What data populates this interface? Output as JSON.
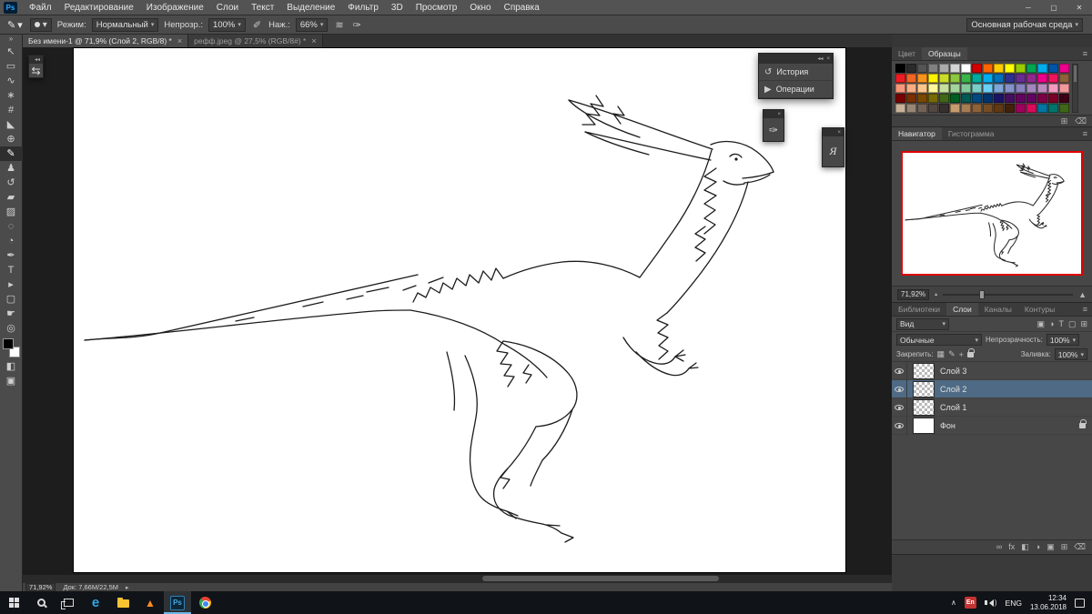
{
  "app": {
    "logo": "Ps"
  },
  "window_controls": {
    "minimize": "─",
    "maximize": "▢",
    "close": "✕"
  },
  "menu_bar": {
    "items": [
      "Файл",
      "Редактирование",
      "Изображение",
      "Слои",
      "Текст",
      "Выделение",
      "Фильтр",
      "3D",
      "Просмотр",
      "Окно",
      "Справка"
    ]
  },
  "ui": {
    "caret": "▾",
    "panel_menu": "≡",
    "toolbar_collapse": "»",
    "float_collapse": "◂◂",
    "float_close": "×",
    "status_arrow": "▸",
    "zoom_out": "▴",
    "zoom_in": "▲",
    "hidden_icons": "∧",
    "wave": ")"
  },
  "options_bar": {
    "tool_icon": "✎",
    "mode_label": "Режим:",
    "mode_value": "Нормальный",
    "opacity_label": "Непрозр.:",
    "opacity_value": "100%",
    "pressure_opacity_icon": "✐",
    "flow_label": "Наж.:",
    "flow_value": "66%",
    "pressure_size_icon": "✑",
    "airbrush_icon": "≋",
    "workspace_value": "Основная рабочая среда"
  },
  "document_tabs": [
    {
      "title": "Без имени-1 @ 71,9% (Слой 2, RGB/8) *",
      "close_glyph": "×",
      "active": true
    },
    {
      "title": "рефф.jpeg @ 27,5% (RGB/8#) *",
      "close_glyph": "×",
      "active": false
    }
  ],
  "toolbar": {
    "tools": [
      {
        "name": "move-tool",
        "glyph": "↖"
      },
      {
        "name": "marquee-tool",
        "glyph": "▭"
      },
      {
        "name": "lasso-tool",
        "glyph": "∿"
      },
      {
        "name": "magic-wand-tool",
        "glyph": "∗"
      },
      {
        "name": "crop-tool",
        "glyph": "#"
      },
      {
        "name": "eyedropper-tool",
        "glyph": "◣"
      },
      {
        "name": "healing-brush-tool",
        "glyph": "⊕"
      },
      {
        "name": "brush-tool",
        "glyph": "✎",
        "selected": true
      },
      {
        "name": "clone-stamp-tool",
        "glyph": "♟"
      },
      {
        "name": "history-brush-tool",
        "glyph": "↺"
      },
      {
        "name": "eraser-tool",
        "glyph": "▰"
      },
      {
        "name": "gradient-tool",
        "glyph": "▨"
      },
      {
        "name": "blur-tool",
        "glyph": "◌"
      },
      {
        "name": "dodge-tool",
        "glyph": "◔"
      },
      {
        "name": "pen-tool",
        "glyph": "✒"
      },
      {
        "name": "type-tool",
        "glyph": "T"
      },
      {
        "name": "path-selection-tool",
        "glyph": "▸"
      },
      {
        "name": "shape-tool",
        "glyph": "▢"
      },
      {
        "name": "hand-tool",
        "glyph": "☛"
      },
      {
        "name": "zoom-tool",
        "glyph": "◎"
      }
    ],
    "quick_mask_glyph": "◧",
    "screen_mode_glyph": "▣"
  },
  "status_bar": {
    "zoom": "71,92%",
    "doc": "Док: 7,66M/22,5M"
  },
  "panels": {
    "color": {
      "tabs": [
        "Цвет",
        "Образцы"
      ],
      "active": "Образцы"
    },
    "swatches_footer": [
      {
        "name": "new-swatch-icon",
        "glyph": "⊞"
      },
      {
        "name": "delete-swatch-icon",
        "glyph": "⌫"
      }
    ],
    "navigator": {
      "tabs": [
        "Навигатор",
        "Гистограмма"
      ],
      "active": "Навигатор",
      "zoom": "71,92%"
    },
    "layers_group": {
      "tabs": [
        "Библиотеки",
        "Слои",
        "Каналы",
        "Контуры"
      ],
      "active": "Слои"
    },
    "layers": {
      "filter_label": "Вид",
      "filter_icons": [
        {
          "name": "filter-pixel-icon",
          "glyph": "▣"
        },
        {
          "name": "filter-adjustment-icon",
          "glyph": "◑"
        },
        {
          "name": "filter-type-icon",
          "glyph": "T"
        },
        {
          "name": "filter-shape-icon",
          "glyph": "▢"
        },
        {
          "name": "filter-smart-icon",
          "glyph": "⊞"
        }
      ],
      "blend_mode": "Обычные",
      "opacity_label": "Непрозрачность:",
      "opacity_value": "100%",
      "lock_label": "Закрепить:",
      "lock_icons": [
        {
          "name": "lock-transparency-icon",
          "glyph": "▦"
        },
        {
          "name": "lock-pixels-icon",
          "glyph": "✎"
        },
        {
          "name": "lock-position-icon",
          "glyph": "+"
        }
      ],
      "fill_label": "Заливка:",
      "fill_value": "100%",
      "items": [
        {
          "name": "Слой 3",
          "visible": true,
          "selected": false,
          "type": "pixel"
        },
        {
          "name": "Слой 2",
          "visible": true,
          "selected": true,
          "type": "pixel"
        },
        {
          "name": "Слой 1",
          "visible": true,
          "selected": false,
          "type": "pixel"
        },
        {
          "name": "Фон",
          "visible": true,
          "selected": false,
          "type": "background",
          "locked": true
        }
      ],
      "footer_icons": [
        {
          "name": "link-layers-icon",
          "glyph": "∞"
        },
        {
          "name": "layer-effects-icon",
          "glyph": "fx"
        },
        {
          "name": "layer-mask-icon",
          "glyph": "◧"
        },
        {
          "name": "adjustment-layer-icon",
          "glyph": "◑"
        },
        {
          "name": "layer-group-icon",
          "glyph": "▣"
        },
        {
          "name": "new-layer-icon",
          "glyph": "⊞"
        },
        {
          "name": "delete-layer-icon",
          "glyph": "⌫"
        }
      ]
    }
  },
  "palette": [
    [
      "#000000",
      "#2b2b2b",
      "#555555",
      "#808080",
      "#aaaaaa",
      "#d4d4d4",
      "#ffffff",
      "#d40000",
      "#ff6600",
      "#ffcc00",
      "#ffff00",
      "#99cc00",
      "#00a651",
      "#00aeef",
      "#0054a6",
      "#ec008c"
    ],
    [
      "#ed1c24",
      "#f26522",
      "#f7941d",
      "#fff200",
      "#cbdb2a",
      "#8dc63f",
      "#39b54a",
      "#00a99d",
      "#00aeef",
      "#0072bc",
      "#2e3192",
      "#662d91",
      "#92278f",
      "#ec008c",
      "#ed145b",
      "#8c6239"
    ],
    [
      "#f7977a",
      "#fbad82",
      "#fdc68c",
      "#fff799",
      "#c6df9c",
      "#a4d49d",
      "#82ca9c",
      "#7bcdc9",
      "#6ccff7",
      "#7ea7d8",
      "#8493ca",
      "#8882be",
      "#a286bd",
      "#bc8cbf",
      "#f49bc1",
      "#f5989d"
    ],
    [
      "#790000",
      "#7b2e00",
      "#7a4900",
      "#786a02",
      "#406618",
      "#005e20",
      "#005952",
      "#004a80",
      "#003471",
      "#1b1464",
      "#450e61",
      "#62055f",
      "#630460",
      "#7b0046",
      "#7a0026",
      "#3d0017"
    ],
    [
      "#c7b299",
      "#998675",
      "#736357",
      "#534741",
      "#362f2d",
      "#c69c6d",
      "#a67c52",
      "#8c6239",
      "#754c24",
      "#603913",
      "#42210b",
      "#9e005d",
      "#db0a5b",
      "#0076a3",
      "#00746b",
      "#406618"
    ]
  ],
  "floating": {
    "toggle_glyph": "⇆",
    "history_panel": {
      "items": [
        {
          "name": "history-panel-button",
          "icon": "↺",
          "label": "История"
        },
        {
          "name": "actions-panel-button",
          "icon": "▶",
          "label": "Операции"
        }
      ]
    },
    "mini_panels": [
      {
        "name": "brushes-panel-icon",
        "glyph": "✑",
        "serif": false
      },
      {
        "name": "character-panel-icon",
        "glyph": "Я",
        "serif": true
      }
    ]
  },
  "taskbar": {
    "apps": [
      {
        "name": "taskbar-edge",
        "kind": "edge",
        "glyph": "e",
        "color": "#30a5e8",
        "active": false
      },
      {
        "name": "taskbar-explorer",
        "kind": "folder",
        "active": false
      },
      {
        "name": "taskbar-vlc",
        "kind": "vlc",
        "glyph": "▲",
        "color": "#ff8b1f",
        "active": false
      },
      {
        "name": "taskbar-photoshop",
        "kind": "ps",
        "glyph": "Ps",
        "active": true
      },
      {
        "name": "taskbar-chrome",
        "kind": "chrome",
        "active": false
      }
    ],
    "tray": {
      "badge": "En",
      "lang": "ENG",
      "time": "12:34",
      "date": "13.06.2018"
    }
  }
}
